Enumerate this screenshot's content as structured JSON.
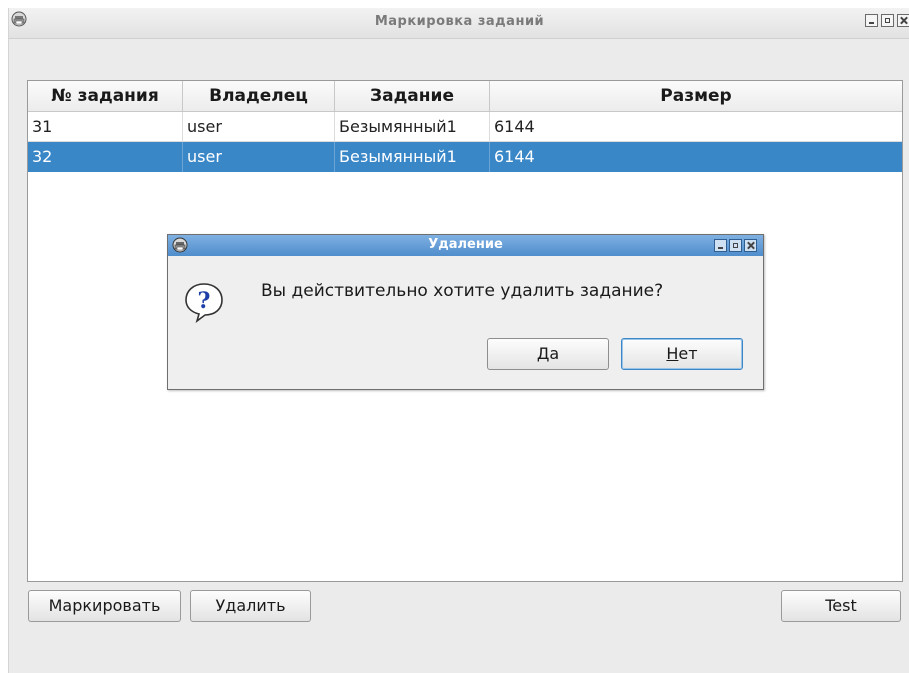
{
  "window": {
    "title": "Маркировка заданий"
  },
  "table": {
    "columns": [
      "№ задания",
      "Владелец",
      "Задание",
      "Размер"
    ],
    "rows": [
      {
        "id": "31",
        "owner": "user",
        "job": "Безымянный1",
        "size": "6144",
        "selected": false
      },
      {
        "id": "32",
        "owner": "user",
        "job": "Безымянный1",
        "size": "6144",
        "selected": true
      }
    ]
  },
  "buttons": {
    "mark": "Маркировать",
    "delete": "Удалить",
    "test": "Test"
  },
  "dialog": {
    "title": "Удаление",
    "message": "Вы действительно хотите удалить задание?",
    "yes_mnemonic": "Д",
    "yes_rest": "а",
    "no_mnemonic": "Н",
    "no_rest": "ет"
  },
  "icons": {
    "app": "printer-icon",
    "dialog_app": "printer-icon",
    "question": "question-icon",
    "minimize": "minimize-icon",
    "maximize": "maximize-icon",
    "close": "close-icon"
  },
  "colors": {
    "selection": "#3a87c8",
    "dialog_titlebar": "#5a96d2"
  }
}
